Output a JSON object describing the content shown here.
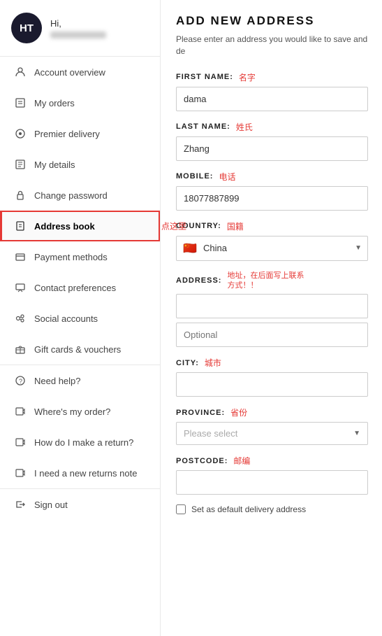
{
  "sidebar": {
    "user": {
      "initials": "HT",
      "greeting": "Hi,"
    },
    "nav_items": [
      {
        "id": "account-overview",
        "label": "Account overview",
        "icon": "👤",
        "active": false
      },
      {
        "id": "my-orders",
        "label": "My orders",
        "icon": "📋",
        "active": false
      },
      {
        "id": "premier-delivery",
        "label": "Premier delivery",
        "icon": "🎯",
        "active": false
      },
      {
        "id": "my-details",
        "label": "My details",
        "icon": "📄",
        "active": false
      },
      {
        "id": "change-password",
        "label": "Change password",
        "icon": "🔒",
        "active": false
      },
      {
        "id": "address-book",
        "label": "Address book",
        "icon": "📖",
        "active": true,
        "annotation": "点这里"
      },
      {
        "id": "payment-methods",
        "label": "Payment methods",
        "icon": "💳",
        "active": false
      },
      {
        "id": "contact-preferences",
        "label": "Contact preferences",
        "icon": "💬",
        "active": false
      },
      {
        "id": "social-accounts",
        "label": "Social accounts",
        "icon": "👥",
        "active": false
      },
      {
        "id": "gift-cards",
        "label": "Gift cards & vouchers",
        "icon": "🎁",
        "active": false
      },
      {
        "id": "need-help",
        "label": "Need help?",
        "icon": "❓",
        "active": false
      },
      {
        "id": "wheres-my-order",
        "label": "Where's my order?",
        "icon": "🔄",
        "active": false
      },
      {
        "id": "how-return",
        "label": "How do I make a return?",
        "icon": "↩",
        "active": false
      },
      {
        "id": "returns-note",
        "label": "I need a new returns note",
        "icon": "↩",
        "active": false
      }
    ],
    "sign_out": "Sign out"
  },
  "main": {
    "title": "ADD NEW ADDRESS",
    "subtitle": "Please enter an address you would like to save and de",
    "fields": {
      "first_name": {
        "label": "FIRST NAME:",
        "annotation": "名字",
        "value": "dama"
      },
      "last_name": {
        "label": "LAST NAME:",
        "annotation": "姓氏",
        "value": "Zhang"
      },
      "mobile": {
        "label": "MOBILE:",
        "annotation": "电话",
        "value": "18077887899"
      },
      "country": {
        "label": "COUNTRY:",
        "annotation": "国籍",
        "value": "China",
        "flag": "🇨🇳"
      },
      "address": {
        "label": "ADDRESS:",
        "annotation": "地址，在后面写上联系方式！！",
        "value": "",
        "optional_placeholder": "Optional"
      },
      "city": {
        "label": "CITY:",
        "annotation": "城市",
        "value": ""
      },
      "province": {
        "label": "PROVINCE:",
        "annotation": "省份",
        "placeholder": "Please select"
      },
      "postcode": {
        "label": "POSTCODE:",
        "annotation": "邮编",
        "value": ""
      }
    },
    "checkbox_label": "Set as default delivery address"
  }
}
